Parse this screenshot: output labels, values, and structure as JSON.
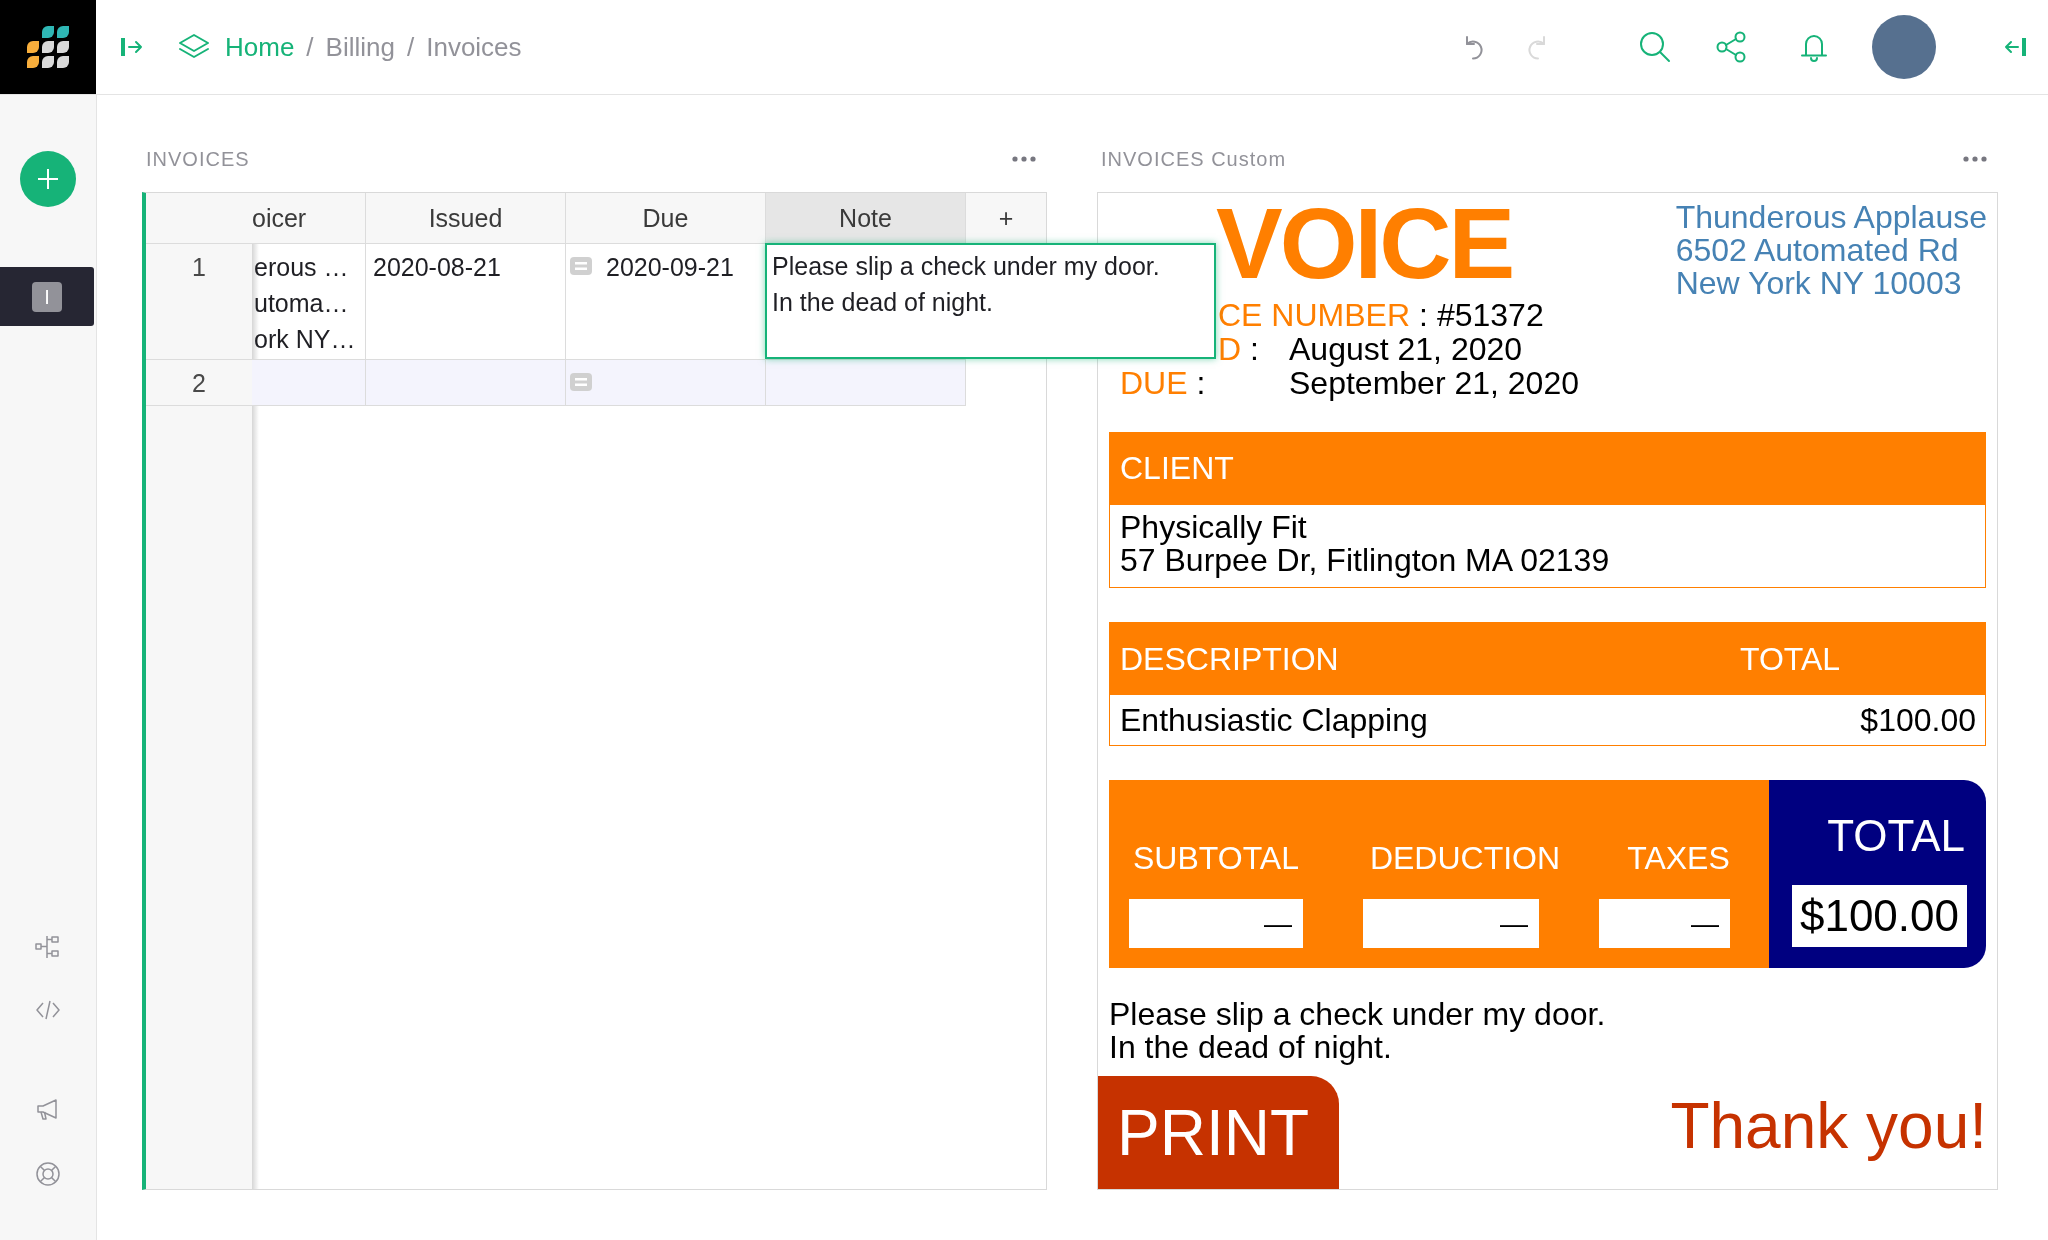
{
  "top_bar": {
    "breadcrumbs": [
      {
        "kind": "link",
        "label": "Home"
      },
      {
        "kind": "separator",
        "label": "/"
      },
      {
        "kind": "text",
        "label": "Billing"
      },
      {
        "kind": "separator",
        "label": "/"
      },
      {
        "kind": "text",
        "label": "Invoices"
      }
    ],
    "history": [
      {
        "kind": "undo",
        "disabled": false
      },
      {
        "kind": "redo",
        "disabled": true
      }
    ]
  },
  "sidebar": {
    "pages": [
      {
        "initial": "I",
        "selected": true
      }
    ]
  },
  "sections": [
    {
      "kind": "table",
      "title": "INVOICES",
      "table": {
        "columns": [
          {
            "label": "oicer",
            "kind": "plain",
            "selected": false
          },
          {
            "label": "Issued",
            "kind": "plain",
            "selected": false
          },
          {
            "label": "Due",
            "kind": "icon",
            "selected": false
          },
          {
            "label": "Note",
            "kind": "plain",
            "selected": true
          }
        ],
        "add_column": "+",
        "rows": [
          {
            "number": "1",
            "kind": "record",
            "cells": [
              [
                "erous …",
                "utoma…",
                "ork NY…"
              ],
              [
                "2020-08-21"
              ],
              [
                "2020-09-21"
              ]
            ]
          },
          {
            "number": "2",
            "kind": "new"
          }
        ],
        "editor": {
          "lines": [
            "Please slip a check under my door.",
            "In the dead of night."
          ]
        }
      }
    },
    {
      "kind": "invoice",
      "title": "INVOICES Custom",
      "invoice": {
        "heading": {
          "text": "VOICE",
          "covered": true
        },
        "meta": [
          {
            "kind": "inline",
            "covered": true,
            "label": "CE NUMBER",
            "separator": ":",
            "value": "#51372"
          },
          {
            "kind": "aligned",
            "covered": true,
            "label": "D",
            "separator": ":",
            "value": "August 21, 2020"
          },
          {
            "kind": "aligned",
            "covered": false,
            "label": "DUE",
            "separator": ":",
            "value": "September 21, 2020"
          }
        ],
        "sender": [
          "Thunderous Applause",
          "6502 Automated Rd",
          "New York NY 10003"
        ],
        "client": {
          "heading": "CLIENT",
          "lines": [
            "Physically Fit",
            "57 Burpee Dr, Fitlington MA 02139"
          ]
        },
        "items": {
          "columns": [
            "DESCRIPTION",
            "TOTAL"
          ],
          "rows": [
            {
              "description": "Enthusiastic Clapping",
              "total": "$100.00"
            }
          ]
        },
        "summary": [
          {
            "label": "SUBTOTAL",
            "value": "—"
          },
          {
            "label": "DEDUCTION",
            "value": "—"
          },
          {
            "label": "TAXES",
            "value": "—"
          }
        ],
        "total": {
          "label": "TOTAL",
          "value": "$100.00"
        },
        "note": [
          "Please slip a check under my door.",
          "In the dead of night."
        ],
        "print_button": "PRINT",
        "thanks": "Thank you!"
      }
    }
  ]
}
